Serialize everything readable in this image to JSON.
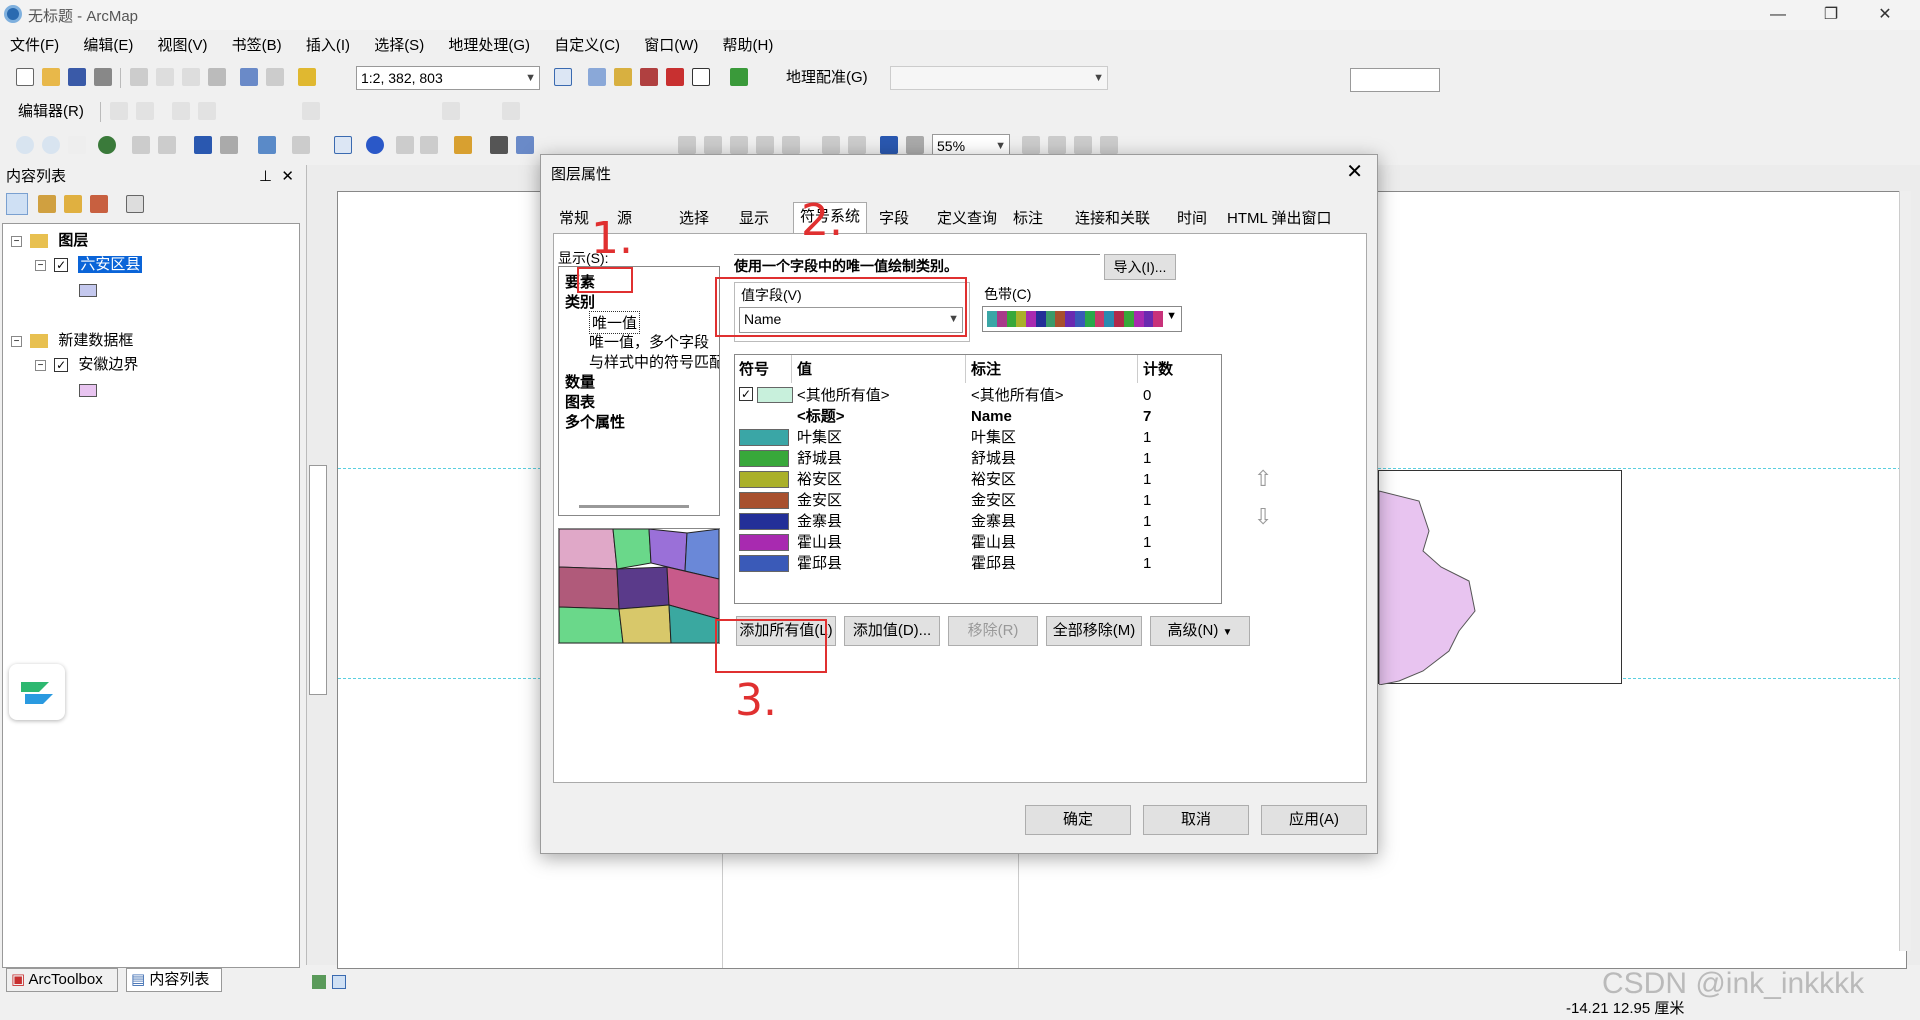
{
  "window": {
    "title": "无标题 - ArcMap"
  },
  "menu": [
    "文件(F)",
    "编辑(E)",
    "视图(V)",
    "书签(B)",
    "插入(I)",
    "选择(S)",
    "地理处理(G)",
    "自定义(C)",
    "窗口(W)",
    "帮助(H)"
  ],
  "toolbar": {
    "scale": "1:2, 382, 803",
    "georef_label": "地理配准(G)",
    "editor_label": "编辑器(R)",
    "zoom": "55%"
  },
  "toc": {
    "title": "内容列表",
    "layers_label": "图层",
    "layer1": "六安区县",
    "frame2": "新建数据框",
    "layer2": "安徽边界",
    "tab_arctoolbox": "ArcToolbox",
    "tab_toc": "内容列表"
  },
  "dialog": {
    "title": "图层属性",
    "tabs": [
      "常规",
      "源",
      "选择",
      "显示",
      "符号系统",
      "字段",
      "定义查询",
      "标注",
      "连接和关联",
      "时间",
      "HTML 弹出窗口"
    ],
    "show_label": "显示(S):",
    "show_items": [
      "要素",
      "类别",
      "唯一值",
      "唯一值，多个字段",
      "与样式中的符号匹配",
      "数量",
      "图表",
      "多个属性"
    ],
    "description": "使用一个字段中的唯一值绘制类别。",
    "import_btn": "导入(I)...",
    "value_field_label": "值字段(V)",
    "value_field": "Name",
    "color_ramp_label": "色带(C)",
    "table_headers": [
      "符号",
      "值",
      "标注",
      "计数"
    ],
    "rows": [
      {
        "value": "<其他所有值>",
        "label": "<其他所有值>",
        "count": "0",
        "color": "#c8f0dc"
      },
      {
        "value": "<标题>",
        "label": "Name",
        "count": "7",
        "color": ""
      },
      {
        "value": "叶集区",
        "label": "叶集区",
        "count": "1",
        "color": "#3aa6a6"
      },
      {
        "value": "舒城县",
        "label": "舒城县",
        "count": "1",
        "color": "#38a83a"
      },
      {
        "value": "裕安区",
        "label": "裕安区",
        "count": "1",
        "color": "#aab02a"
      },
      {
        "value": "金安区",
        "label": "金安区",
        "count": "1",
        "color": "#a8502e"
      },
      {
        "value": "金寨县",
        "label": "金寨县",
        "count": "1",
        "color": "#232f98"
      },
      {
        "value": "霍山县",
        "label": "霍山县",
        "count": "1",
        "color": "#a82ab0"
      },
      {
        "value": "霍邱县",
        "label": "霍邱县",
        "count": "1",
        "color": "#3a5ab8"
      }
    ],
    "btn_add_all": "添加所有值(L)",
    "btn_add": "添加值(D)...",
    "btn_remove": "移除(R)",
    "btn_remove_all": "全部移除(M)",
    "btn_advanced": "高级(N)",
    "ok": "确定",
    "cancel": "取消",
    "apply": "应用(A)"
  },
  "annotations": [
    "1.",
    "2.",
    "3."
  ],
  "status": {
    "coords": "-14.21  12.95 厘米",
    "watermark": "CSDN @ink_inkkkk"
  }
}
